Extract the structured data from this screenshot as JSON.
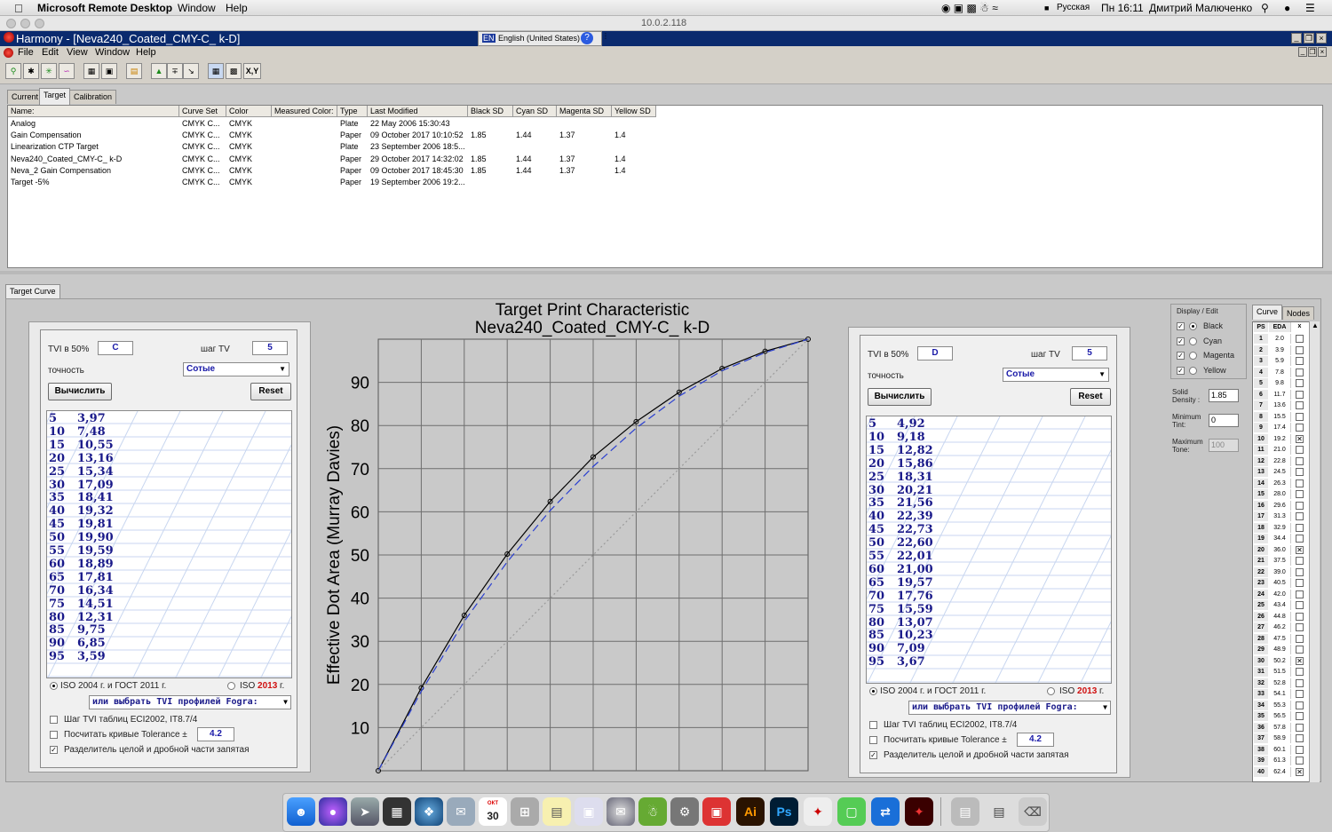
{
  "mac": {
    "app": "Microsoft Remote Desktop",
    "menus": [
      "Window",
      "Help"
    ],
    "input_lang": "Русская",
    "clock": "Пн 16:11",
    "user": "Дмитрий Малюченко"
  },
  "rd": {
    "ip": "10.0.2.118"
  },
  "harmony": {
    "title": "Harmony - [Neva240_Coated_CMY-C_ k-D]",
    "lang": "English (United States)",
    "lang_code": "EN",
    "menus": [
      "File",
      "Edit",
      "View",
      "Window",
      "Help"
    ],
    "toolbar_xy": "X,Y"
  },
  "tabs": [
    "Current",
    "Target",
    "Calibration"
  ],
  "table": {
    "headers": [
      "Name:",
      "Curve Set",
      "Color",
      "Measured Color:",
      "Type",
      "Last Modified",
      "Black SD",
      "Cyan SD",
      "Magenta SD",
      "Yellow SD"
    ],
    "rows": [
      [
        "Analog",
        "CMYK C...",
        "CMYK",
        "",
        "Plate",
        "22 May 2006 15:30:43",
        "",
        "",
        "",
        ""
      ],
      [
        "Gain Compensation",
        "CMYK C...",
        "CMYK",
        "",
        "Paper",
        "09 October 2017 10:10:52",
        "1.85",
        "1.44",
        "1.37",
        "1.4"
      ],
      [
        "Linearization CTP Target",
        "CMYK C...",
        "CMYK",
        "",
        "Plate",
        "23 September 2006 18:5...",
        "",
        "",
        "",
        ""
      ],
      [
        "Neva240_Coated_CMY-C_ k-D",
        "CMYK C...",
        "CMYK",
        "",
        "Paper",
        "29 October 2017 14:32:02",
        "1.85",
        "1.44",
        "1.37",
        "1.4"
      ],
      [
        "Neva_2 Gain Compensation",
        "CMYK C...",
        "CMYK",
        "",
        "Paper",
        "09 October 2017 18:45:30",
        "1.85",
        "1.44",
        "1.37",
        "1.4"
      ],
      [
        "Target -5%",
        "CMYK C...",
        "CMYK",
        "",
        "Paper",
        "19 September 2006 19:2...",
        "",
        "",
        "",
        ""
      ]
    ]
  },
  "target_curve_tab": "Target Curve",
  "calc_left": {
    "tvi_label": "TVI в 50%",
    "tvi_value": "C",
    "step_label": "шаг TV",
    "step_value": "5",
    "precision_label": "точность",
    "precision_value": "Сотые",
    "calc_btn": "Вычислить",
    "reset_btn": "Reset",
    "rows": [
      [
        "5",
        "3,97"
      ],
      [
        "10",
        "7,48"
      ],
      [
        "15",
        "10,55"
      ],
      [
        "20",
        "13,16"
      ],
      [
        "25",
        "15,34"
      ],
      [
        "30",
        "17,09"
      ],
      [
        "35",
        "18,41"
      ],
      [
        "40",
        "19,32"
      ],
      [
        "45",
        "19,81"
      ],
      [
        "50",
        "19,90"
      ],
      [
        "55",
        "19,59"
      ],
      [
        "60",
        "18,89"
      ],
      [
        "65",
        "17,81"
      ],
      [
        "70",
        "16,34"
      ],
      [
        "75",
        "14,51"
      ],
      [
        "80",
        "12,31"
      ],
      [
        "85",
        "9,75"
      ],
      [
        "90",
        "6,85"
      ],
      [
        "95",
        "3,59"
      ]
    ],
    "radio1": "ISO 2004 г. и ГОСТ 2011 г.",
    "radio2_pre": "ISO ",
    "radio2_year": "2013",
    "radio2_post": " г.",
    "fogra": "или выбрать TVI профилей Fogra:",
    "chk1": "Шаг TVI таблиц ECI2002, IT8.7/4",
    "chk2": "Посчитать кривые Tolerance ±",
    "tolerance": "4.2",
    "chk3": "Разделитель целой и дробной части запятая"
  },
  "calc_right": {
    "tvi_label": "TVI в 50%",
    "tvi_value": "D",
    "step_label": "шаг TV",
    "step_value": "5",
    "precision_label": "точность",
    "precision_value": "Сотые",
    "calc_btn": "Вычислить",
    "reset_btn": "Reset",
    "rows": [
      [
        "5",
        "4,92"
      ],
      [
        "10",
        "9,18"
      ],
      [
        "15",
        "12,82"
      ],
      [
        "20",
        "15,86"
      ],
      [
        "25",
        "18,31"
      ],
      [
        "30",
        "20,21"
      ],
      [
        "35",
        "21,56"
      ],
      [
        "40",
        "22,39"
      ],
      [
        "45",
        "22,73"
      ],
      [
        "50",
        "22,60"
      ],
      [
        "55",
        "22,01"
      ],
      [
        "60",
        "21,00"
      ],
      [
        "65",
        "19,57"
      ],
      [
        "70",
        "17,76"
      ],
      [
        "75",
        "15,59"
      ],
      [
        "80",
        "13,07"
      ],
      [
        "85",
        "10,23"
      ],
      [
        "90",
        "7,09"
      ],
      [
        "95",
        "3,67"
      ]
    ],
    "radio1": "ISO 2004 г. и ГОСТ 2011 г.",
    "radio2_pre": "ISO ",
    "radio2_year": "2013",
    "radio2_post": " г.",
    "fogra": "или выбрать TVI профилей Fogra:",
    "chk1": "Шаг TVI таблиц ECI2002, IT8.7/4",
    "chk2": "Посчитать кривые Tolerance ±",
    "tolerance": "4.2",
    "chk3": "Разделитель целой и дробной части запятая"
  },
  "chart_data": {
    "type": "line",
    "title": "Target Print Characteristic",
    "subtitle": "Neva240_Coated_CMY-C_ k-D",
    "ylabel": "Effective Dot Area (Murray Davies)",
    "xlim": [
      0,
      100
    ],
    "ylim": [
      0,
      100
    ],
    "yticks": [
      10,
      20,
      30,
      40,
      50,
      60,
      70,
      80,
      90
    ],
    "grid": true,
    "series": [
      {
        "name": "",
        "style": "solid",
        "color": "#000000",
        "x": [
          0,
          10,
          20,
          30,
          40,
          50,
          60,
          70,
          80,
          90,
          100
        ],
        "y": [
          0,
          19.2,
          36.0,
          50.2,
          62.4,
          72.7,
          80.9,
          87.7,
          93.2,
          97.2,
          100
        ]
      },
      {
        "name": "",
        "style": "dashed",
        "color": "#2a3fd0",
        "x": [
          0,
          10,
          20,
          30,
          40,
          50,
          60,
          70,
          80,
          90,
          100
        ],
        "y": [
          0,
          18.4,
          34.6,
          48.4,
          60.3,
          70.5,
          79.4,
          86.8,
          92.7,
          96.9,
          100
        ]
      },
      {
        "name": "",
        "style": "dotted",
        "color": "#9a9a9a",
        "x": [
          0,
          100
        ],
        "y": [
          0,
          100
        ]
      }
    ]
  },
  "display_edit": {
    "title": "Display / Edit",
    "items": [
      {
        "label": "Black",
        "checked": true,
        "selected": true
      },
      {
        "label": "Cyan",
        "checked": true,
        "selected": false
      },
      {
        "label": "Magenta",
        "checked": true,
        "selected": false
      },
      {
        "label": "Yellow",
        "checked": true,
        "selected": false
      }
    ],
    "solid_density_label": "Solid Density :",
    "solid_density": "1.85",
    "min_tint_label": "Minimum Tint:",
    "min_tint": "0",
    "max_tone_label": "Maximum Tone:",
    "max_tone": "100"
  },
  "curve_tabs": [
    "Curve",
    "Nodes"
  ],
  "nodes": {
    "headers": [
      "PS",
      "EDA",
      "x"
    ],
    "rows": [
      [
        "1",
        "2.0",
        false
      ],
      [
        "2",
        "3.9",
        false
      ],
      [
        "3",
        "5.9",
        false
      ],
      [
        "4",
        "7.8",
        false
      ],
      [
        "5",
        "9.8",
        false
      ],
      [
        "6",
        "11.7",
        false
      ],
      [
        "7",
        "13.6",
        false
      ],
      [
        "8",
        "15.5",
        false
      ],
      [
        "9",
        "17.4",
        false
      ],
      [
        "10",
        "19.2",
        true
      ],
      [
        "11",
        "21.0",
        false
      ],
      [
        "12",
        "22.8",
        false
      ],
      [
        "13",
        "24.5",
        false
      ],
      [
        "14",
        "26.3",
        false
      ],
      [
        "15",
        "28.0",
        false
      ],
      [
        "16",
        "29.6",
        false
      ],
      [
        "17",
        "31.3",
        false
      ],
      [
        "18",
        "32.9",
        false
      ],
      [
        "19",
        "34.4",
        false
      ],
      [
        "20",
        "36.0",
        true
      ],
      [
        "21",
        "37.5",
        false
      ],
      [
        "22",
        "39.0",
        false
      ],
      [
        "23",
        "40.5",
        false
      ],
      [
        "24",
        "42.0",
        false
      ],
      [
        "25",
        "43.4",
        false
      ],
      [
        "26",
        "44.8",
        false
      ],
      [
        "27",
        "46.2",
        false
      ],
      [
        "28",
        "47.5",
        false
      ],
      [
        "29",
        "48.9",
        false
      ],
      [
        "30",
        "50.2",
        true
      ],
      [
        "31",
        "51.5",
        false
      ],
      [
        "32",
        "52.8",
        false
      ],
      [
        "33",
        "54.1",
        false
      ],
      [
        "34",
        "55.3",
        false
      ],
      [
        "35",
        "56.5",
        false
      ],
      [
        "36",
        "57.8",
        false
      ],
      [
        "37",
        "58.9",
        false
      ],
      [
        "38",
        "60.1",
        false
      ],
      [
        "39",
        "61.3",
        false
      ],
      [
        "40",
        "62.4",
        true
      ]
    ]
  },
  "dock": {
    "calendar_day": "30",
    "calendar_month": "ОКТ",
    "illustrator": "Ai",
    "photoshop": "Ps"
  }
}
